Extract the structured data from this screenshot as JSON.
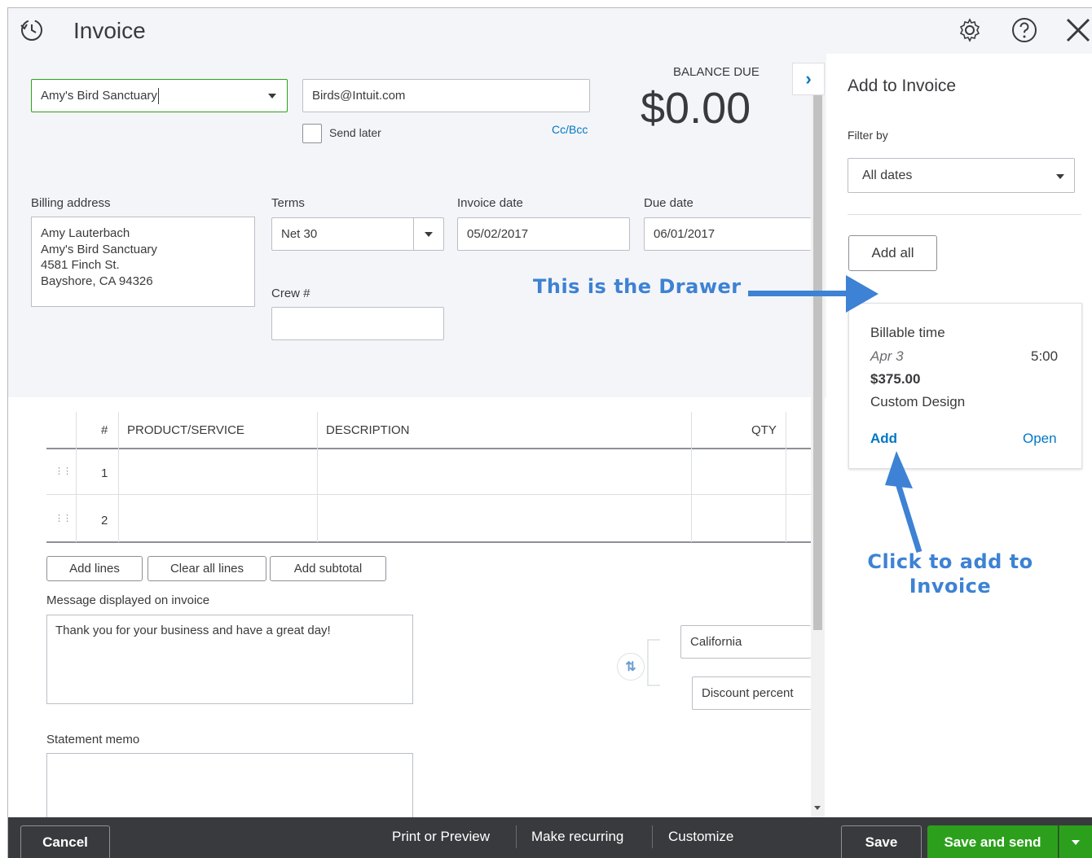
{
  "window": {
    "title": "Invoice"
  },
  "customer": {
    "name": "Amy's Bird Sanctuary",
    "email": "Birds@Intuit.com",
    "send_later_label": "Send later",
    "ccbcc_label": "Cc/Bcc"
  },
  "balance": {
    "label": "BALANCE DUE",
    "amount": "$0.00"
  },
  "billing": {
    "label": "Billing address",
    "lines": [
      "Amy Lauterbach",
      "Amy's Bird Sanctuary",
      "4581 Finch St.",
      "Bayshore, CA  94326"
    ]
  },
  "terms": {
    "label": "Terms",
    "value": "Net 30"
  },
  "invoice_date": {
    "label": "Invoice date",
    "value": "05/02/2017"
  },
  "due_date": {
    "label": "Due date",
    "value": "06/01/2017"
  },
  "crew": {
    "label": "Crew #",
    "value": ""
  },
  "table": {
    "columns": {
      "num": "#",
      "product": "PRODUCT/SERVICE",
      "description": "DESCRIPTION",
      "qty": "QTY"
    },
    "rows": [
      {
        "num": "1"
      },
      {
        "num": "2"
      }
    ]
  },
  "line_buttons": {
    "add_lines": "Add lines",
    "clear_all": "Clear all lines",
    "add_subtotal": "Add subtotal"
  },
  "message": {
    "label": "Message displayed on invoice",
    "value": "Thank you for your business and have a great day!"
  },
  "statement_memo": {
    "label": "Statement memo",
    "value": ""
  },
  "tax": {
    "location": "California",
    "discount": "Discount percent"
  },
  "drawer": {
    "title": "Add to Invoice",
    "filter_label": "Filter by",
    "filter_value": "All dates",
    "add_all": "Add all",
    "card": {
      "title": "Billable time",
      "date": "Apr 3",
      "hours": "5:00",
      "amount": "$375.00",
      "description": "Custom Design",
      "add": "Add",
      "open": "Open"
    }
  },
  "annotations": {
    "drawer": "This is the Drawer",
    "click_line1": "Click to add to",
    "click_line2": "Invoice"
  },
  "footer": {
    "cancel": "Cancel",
    "print": "Print or Preview",
    "recurring": "Make recurring",
    "customize": "Customize",
    "save": "Save",
    "save_send": "Save and send"
  },
  "colors": {
    "accent_green": "#2ca01c",
    "link_blue": "#0077c5",
    "annotation_blue": "#3d82d4",
    "footer_bg": "#393a3d"
  }
}
